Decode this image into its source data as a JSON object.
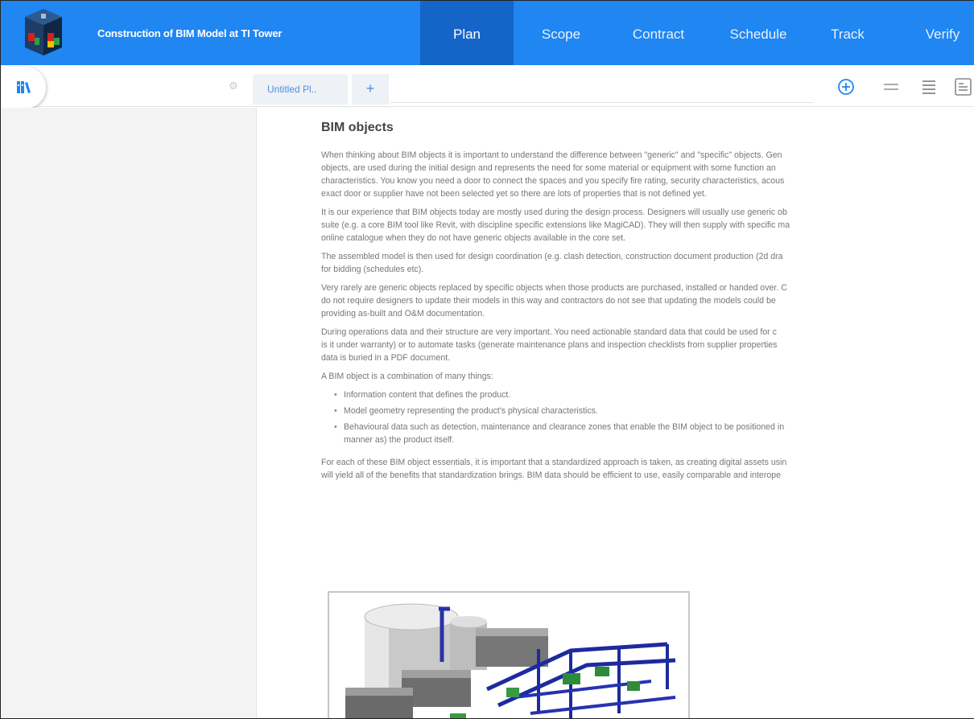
{
  "header": {
    "project_title": "Construction of BIM Model at TI Tower",
    "nav": [
      {
        "label": "Plan",
        "active": true
      },
      {
        "label": "Scope",
        "active": false
      },
      {
        "label": "Contract",
        "active": false
      },
      {
        "label": "Schedule",
        "active": false
      },
      {
        "label": "Track",
        "active": false
      },
      {
        "label": "Verify",
        "active": false
      }
    ]
  },
  "toolbar": {
    "tab_label": "Untitled Pl..",
    "add_tab_label": "+",
    "icons": [
      "add-circle-icon",
      "minus-lines-icon",
      "list-lines-icon",
      "document-icon"
    ]
  },
  "document": {
    "heading": "BIM objects",
    "paragraphs": [
      "When thinking about BIM objects it is important to understand the difference between \"generic\" and \"specific\" objects. Gen\nobjects, are used during the initial design and represents the need for some material or equipment with some function an\ncharacteristics. You know you need a door to connect the spaces and you specify fire rating, security characteristics, acous\nexact door or supplier have not been selected yet so there are lots of properties that is not defined yet.",
      "It is our experience that BIM objects today are mostly used during the design process. Designers will usually use generic ob\nsuite (e.g. a core BIM tool like Revit, with discipline specific extensions like MagiCAD). They will then supply with specific ma\nonline catalogue when they do not have generic objects available in the core set.",
      "The assembled model is then used for design coordination (e.g. clash detection, construction document production (2d dra\nfor bidding (schedules etc).",
      "Very rarely are generic objects replaced by specific objects when those products are purchased, installed or handed over. C\ndo not require designers to update their models in this way and contractors do not see that updating the models could be\nproviding as-built and O&M documentation.",
      "During operations data and their structure are very important. You need actionable standard data that could be used for c\nis it under warranty) or to automate tasks (generate maintenance plans and inspection checklists from supplier properties\ndata is buried in a PDF document.",
      "A BIM object is a combination of many things:"
    ],
    "bullets": [
      "Information content that defines the product.",
      "Model geometry representing the product's physical characteristics.",
      "Behavioural data such as detection, maintenance and clearance zones that enable the BIM object to be positioned in\nmanner as) the product itself."
    ],
    "closing": "For each of these BIM object essentials, it is important that a standardized approach is taken, as creating digital assets usin\nwill yield all of the benefits that standardization brings. BIM data should be efficient to use, easily comparable and interope"
  },
  "colors": {
    "header_blue": "#1f86f2",
    "active_nav": "#1565c9",
    "link_blue": "#4b8fe0"
  }
}
